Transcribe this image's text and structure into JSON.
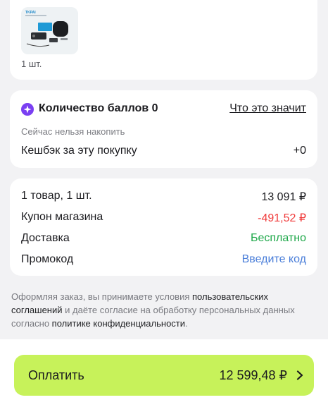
{
  "product": {
    "quantity": "1 шт.",
    "image_caption": "TKPAI"
  },
  "bonus": {
    "icon": "purple-star-badge-icon",
    "title": "Количество баллов 0",
    "link": "Что это значит",
    "note": "Сейчас нельзя накопить",
    "cashback_label": "Кешбэк за эту покупку",
    "cashback_value": "+0"
  },
  "summary": {
    "items_label": "1 товар, 1 шт.",
    "items_value": "13 091 ₽",
    "coupon_label": "Купон магазина",
    "coupon_value": "-491,52 ₽",
    "delivery_label": "Доставка",
    "delivery_value": "Бесплатно",
    "promo_label": "Промокод",
    "promo_value": "Введите код"
  },
  "legal": {
    "part1": "Оформляя заказ, вы принимаете условия ",
    "link1": "пользовательских соглашений",
    "part2": " и даёте согласие на обработку персональных данных согласно ",
    "link2": "политике конфиденциальности",
    "part3": "."
  },
  "footer": {
    "pay_label": "Оплатить",
    "pay_amount": "12 599,48 ₽"
  },
  "colors": {
    "accent_button": "#c7f25a",
    "discount": "#f03a3a",
    "free": "#1fa84a",
    "link": "#4a7ed9",
    "bonus_icon": "#7a3ff2"
  }
}
